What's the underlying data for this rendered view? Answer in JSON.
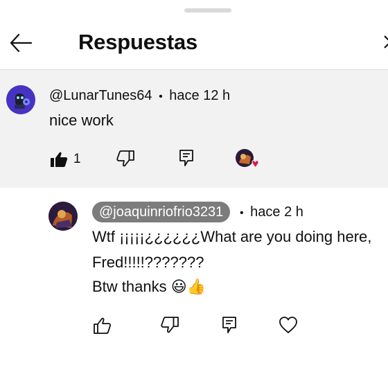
{
  "header": {
    "title": "Respuestas",
    "back_icon": "arrow-left-icon",
    "close_icon": "close-icon"
  },
  "parent_comment": {
    "handle": "@LunarTunes64",
    "separator": "•",
    "time": "hace 12 h",
    "text": "nice work",
    "likes": "1",
    "like_icon": "thumb-up-filled-icon",
    "dislike_icon": "thumb-down-icon",
    "reply_icon": "reply-icon",
    "creator_heart_icon": "creator-heart-icon"
  },
  "reply": {
    "handle": "@joaquinriofrio3231",
    "separator": "•",
    "time": "hace 2 h",
    "text_line1": "Wtf ¡¡¡¡¡¿¿¿¿¿¿What are you doing here,",
    "text_line2": "Fred!!!!!???????",
    "text_line3": "Btw thanks 😃👍",
    "like_icon": "thumb-up-icon",
    "dislike_icon": "thumb-down-icon",
    "reply_icon": "reply-icon",
    "heart_icon": "heart-icon"
  },
  "colors": {
    "parent_bg": "#f2f2f2",
    "mention_pill": "#7c7c7c",
    "heart": "#e0144c"
  }
}
